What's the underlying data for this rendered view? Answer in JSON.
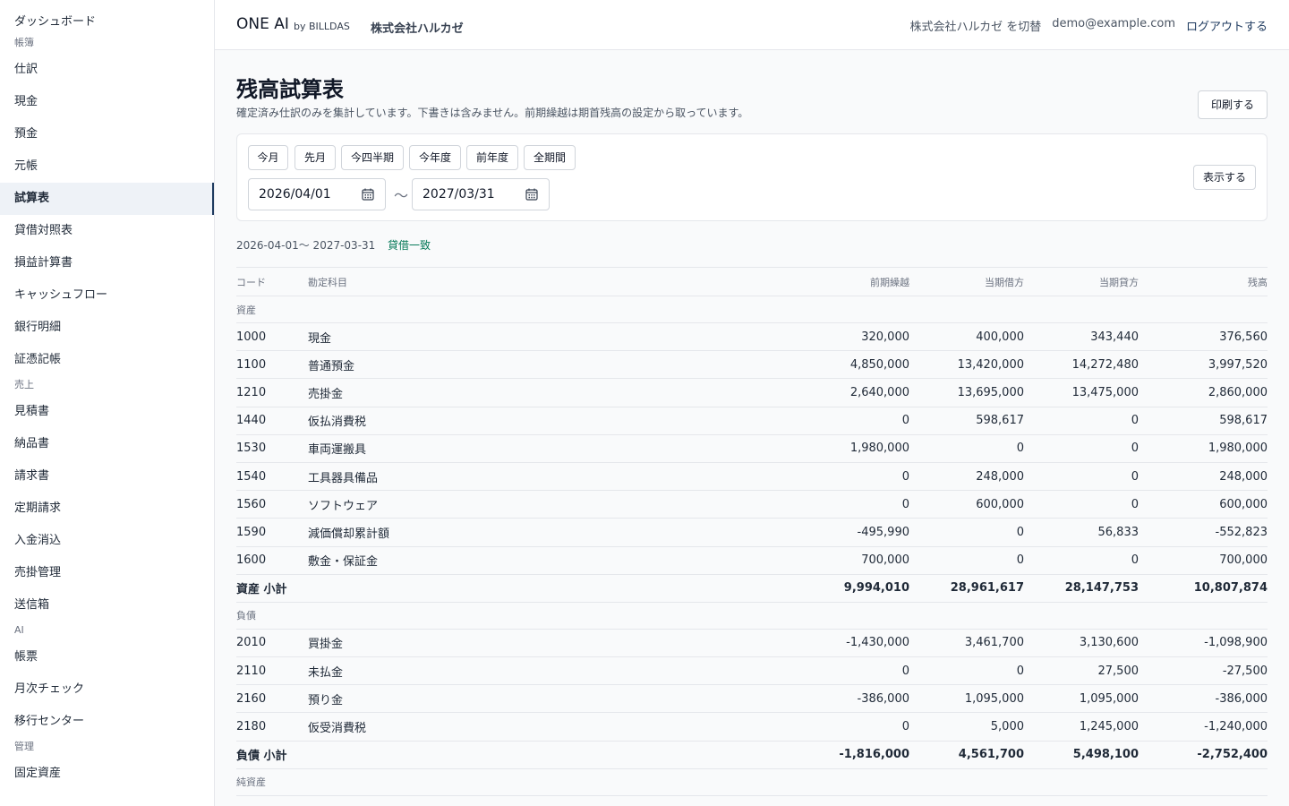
{
  "sidebar": {
    "groups": [
      {
        "section": "",
        "items": [
          {
            "label": "ダッシュボード"
          }
        ]
      },
      {
        "section": "帳簿",
        "items": [
          {
            "label": "仕訳"
          },
          {
            "label": "現金"
          },
          {
            "label": "預金"
          },
          {
            "label": "元帳"
          },
          {
            "label": "試算表",
            "active": true
          },
          {
            "label": "貸借対照表"
          },
          {
            "label": "損益計算書"
          },
          {
            "label": "キャッシュフロー"
          },
          {
            "label": "銀行明細"
          },
          {
            "label": "証憑記帳"
          }
        ]
      },
      {
        "section": "売上",
        "items": [
          {
            "label": "見積書"
          },
          {
            "label": "納品書"
          },
          {
            "label": "請求書"
          },
          {
            "label": "定期請求"
          },
          {
            "label": "入金消込"
          },
          {
            "label": "売掛管理"
          },
          {
            "label": "送信箱"
          }
        ]
      },
      {
        "section": "AI",
        "items": [
          {
            "label": "帳票"
          },
          {
            "label": "月次チェック"
          },
          {
            "label": "移行センター"
          }
        ]
      },
      {
        "section": "管理",
        "items": [
          {
            "label": "固定資産"
          }
        ]
      }
    ]
  },
  "header": {
    "brand": "ONE AI",
    "brand_by": "by BILLDAS",
    "company": "株式会社ハルカゼ",
    "switch_label": "株式会社ハルカゼ を切替",
    "email": "demo@example.com",
    "logout_label": "ログアウトする"
  },
  "page": {
    "title": "残高試算表",
    "description": "確定済み仕訳のみを集計しています。下書きは含みません。前期繰越は期首残高の設定から取っています。",
    "print_label": "印刷する",
    "presets": [
      "今月",
      "先月",
      "今四半期",
      "今年度",
      "前年度",
      "全期間"
    ],
    "date_from": "2026/04/01",
    "date_to": "2027/03/31",
    "tilde": "〜",
    "show_label": "表示する",
    "range_text": "2026-04-01〜 2027-03-31",
    "balance_status": "貸借一致"
  },
  "table": {
    "headers": {
      "code": "コード",
      "name": "勘定科目",
      "opening": "前期繰越",
      "debit": "当期借方",
      "credit": "当期貸方",
      "balance": "残高"
    },
    "rows": [
      {
        "type": "section",
        "label": "資産"
      },
      {
        "type": "row",
        "code": "1000",
        "name": "現金",
        "opening": "320,000",
        "debit": "400,000",
        "credit": "343,440",
        "balance": "376,560"
      },
      {
        "type": "row",
        "code": "1100",
        "name": "普通預金",
        "opening": "4,850,000",
        "debit": "13,420,000",
        "credit": "14,272,480",
        "balance": "3,997,520"
      },
      {
        "type": "row",
        "code": "1210",
        "name": "売掛金",
        "opening": "2,640,000",
        "debit": "13,695,000",
        "credit": "13,475,000",
        "balance": "2,860,000"
      },
      {
        "type": "row",
        "code": "1440",
        "name": "仮払消費税",
        "opening": "0",
        "debit": "598,617",
        "credit": "0",
        "balance": "598,617"
      },
      {
        "type": "row",
        "code": "1530",
        "name": "車両運搬具",
        "opening": "1,980,000",
        "debit": "0",
        "credit": "0",
        "balance": "1,980,000"
      },
      {
        "type": "row",
        "code": "1540",
        "name": "工具器具備品",
        "opening": "0",
        "debit": "248,000",
        "credit": "0",
        "balance": "248,000"
      },
      {
        "type": "row",
        "code": "1560",
        "name": "ソフトウェア",
        "opening": "0",
        "debit": "600,000",
        "credit": "0",
        "balance": "600,000"
      },
      {
        "type": "row",
        "code": "1590",
        "name": "減価償却累計額",
        "opening": "-495,990",
        "debit": "0",
        "credit": "56,833",
        "balance": "-552,823"
      },
      {
        "type": "row",
        "code": "1600",
        "name": "敷金・保証金",
        "opening": "700,000",
        "debit": "0",
        "credit": "0",
        "balance": "700,000"
      },
      {
        "type": "subtotal",
        "code": "資産 小計",
        "name": "",
        "opening": "9,994,010",
        "debit": "28,961,617",
        "credit": "28,147,753",
        "balance": "10,807,874"
      },
      {
        "type": "section",
        "label": "負債"
      },
      {
        "type": "row",
        "code": "2010",
        "name": "買掛金",
        "opening": "-1,430,000",
        "debit": "3,461,700",
        "credit": "3,130,600",
        "balance": "-1,098,900"
      },
      {
        "type": "row",
        "code": "2110",
        "name": "未払金",
        "opening": "0",
        "debit": "0",
        "credit": "27,500",
        "balance": "-27,500"
      },
      {
        "type": "row",
        "code": "2160",
        "name": "預り金",
        "opening": "-386,000",
        "debit": "1,095,000",
        "credit": "1,095,000",
        "balance": "-386,000"
      },
      {
        "type": "row",
        "code": "2180",
        "name": "仮受消費税",
        "opening": "0",
        "debit": "5,000",
        "credit": "1,245,000",
        "balance": "-1,240,000"
      },
      {
        "type": "subtotal",
        "code": "負債 小計",
        "name": "",
        "opening": "-1,816,000",
        "debit": "4,561,700",
        "credit": "5,498,100",
        "balance": "-2,752,400"
      },
      {
        "type": "section",
        "label": "純資産"
      }
    ]
  },
  "colors": {
    "accent": "#1e3a5f",
    "success": "#047857",
    "border": "#e5e7eb"
  }
}
